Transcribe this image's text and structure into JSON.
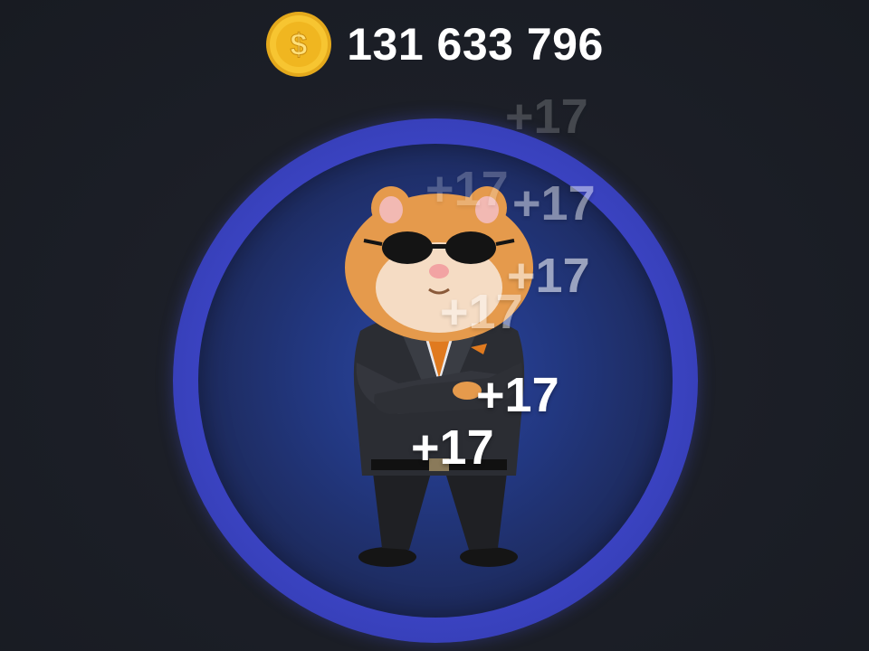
{
  "header": {
    "coin_icon": "dollar-coin-icon",
    "balance": "131 633 796"
  },
  "tap_area": {
    "character": "hamster-ceo-character",
    "floating_labels": [
      "+17",
      "+17",
      "+17",
      "+17",
      "+17",
      "+17",
      "+17"
    ]
  },
  "colors": {
    "background": "#1b1e26",
    "ring": "#3b44c4",
    "inner_circle": "#22377f",
    "coin": "#f7c531",
    "text": "#ffffff"
  }
}
